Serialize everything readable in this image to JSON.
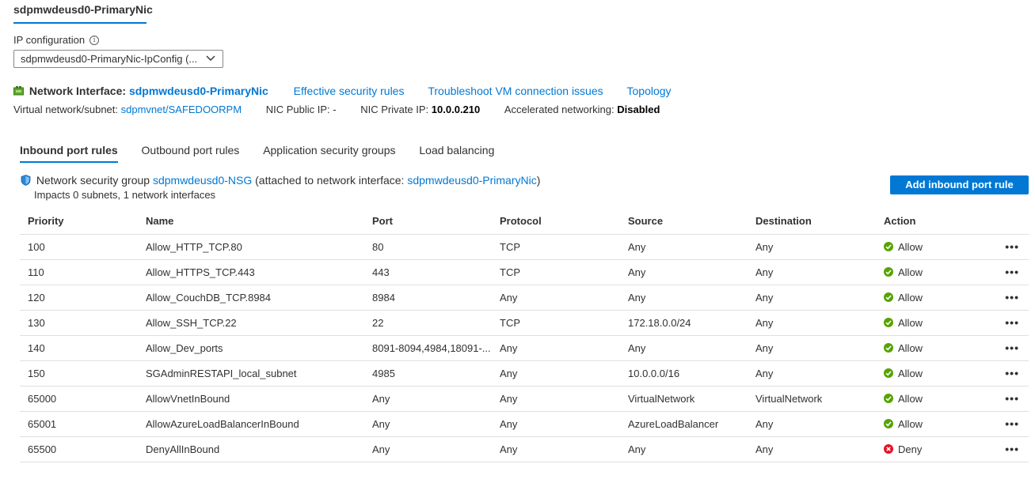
{
  "header": {
    "tab_title": "sdpmwdeusd0-PrimaryNic",
    "ip_config_label": "IP configuration",
    "ip_config_value": "sdpmwdeusd0-PrimaryNic-IpConfig (..."
  },
  "nic": {
    "label": "Network Interface:",
    "name": "sdpmwdeusd0-PrimaryNic",
    "links": {
      "effective_rules": "Effective security rules",
      "troubleshoot": "Troubleshoot VM connection issues",
      "topology": "Topology"
    },
    "vnet_label": "Virtual network/subnet:",
    "vnet_value": "sdpmvnet/SAFEDOORPM",
    "public_ip_label": "NIC Public IP:",
    "public_ip_value": "-",
    "private_ip_label": "NIC Private IP:",
    "private_ip_value": "10.0.0.210",
    "accel_label": "Accelerated networking:",
    "accel_value": "Disabled"
  },
  "tabs": {
    "inbound": "Inbound port rules",
    "outbound": "Outbound port rules",
    "asg": "Application security groups",
    "lb": "Load balancing"
  },
  "nsg": {
    "prefix": "Network security group",
    "name": "sdpmwdeusd0-NSG",
    "attached_prefix": "(attached to network interface:",
    "attached_name": "sdpmwdeusd0-PrimaryNic",
    "attached_suffix": ")",
    "impacts": "Impacts 0 subnets, 1 network interfaces",
    "add_button": "Add inbound port rule"
  },
  "table": {
    "headers": {
      "priority": "Priority",
      "name": "Name",
      "port": "Port",
      "protocol": "Protocol",
      "source": "Source",
      "destination": "Destination",
      "action": "Action"
    },
    "more_label": "•••",
    "rows": [
      {
        "priority": "100",
        "name": "Allow_HTTP_TCP.80",
        "port": "80",
        "protocol": "TCP",
        "source": "Any",
        "destination": "Any",
        "action": "Allow"
      },
      {
        "priority": "110",
        "name": "Allow_HTTPS_TCP.443",
        "port": "443",
        "protocol": "TCP",
        "source": "Any",
        "destination": "Any",
        "action": "Allow"
      },
      {
        "priority": "120",
        "name": "Allow_CouchDB_TCP.8984",
        "port": "8984",
        "protocol": "Any",
        "source": "Any",
        "destination": "Any",
        "action": "Allow"
      },
      {
        "priority": "130",
        "name": "Allow_SSH_TCP.22",
        "port": "22",
        "protocol": "TCP",
        "source": "172.18.0.0/24",
        "destination": "Any",
        "action": "Allow"
      },
      {
        "priority": "140",
        "name": "Allow_Dev_ports",
        "port": "8091-8094,4984,18091-...",
        "protocol": "Any",
        "source": "Any",
        "destination": "Any",
        "action": "Allow"
      },
      {
        "priority": "150",
        "name": "SGAdminRESTAPI_local_subnet",
        "port": "4985",
        "protocol": "Any",
        "source": "10.0.0.0/16",
        "destination": "Any",
        "action": "Allow"
      },
      {
        "priority": "65000",
        "name": "AllowVnetInBound",
        "port": "Any",
        "protocol": "Any",
        "source": "VirtualNetwork",
        "destination": "VirtualNetwork",
        "action": "Allow"
      },
      {
        "priority": "65001",
        "name": "AllowAzureLoadBalancerInBound",
        "port": "Any",
        "protocol": "Any",
        "source": "AzureLoadBalancer",
        "destination": "Any",
        "action": "Allow"
      },
      {
        "priority": "65500",
        "name": "DenyAllInBound",
        "port": "Any",
        "protocol": "Any",
        "source": "Any",
        "destination": "Any",
        "action": "Deny"
      }
    ]
  },
  "colors": {
    "accent": "#0078d4",
    "allow": "#57a300",
    "deny": "#e81123"
  }
}
